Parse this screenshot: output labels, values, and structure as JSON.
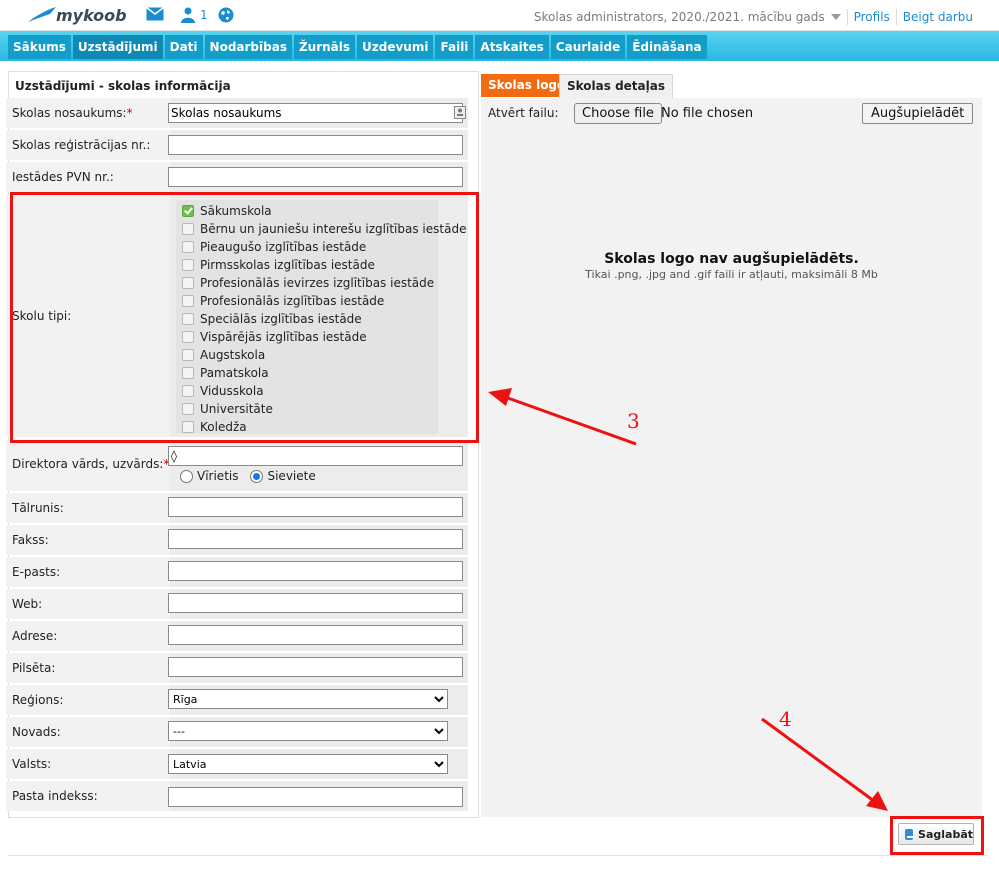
{
  "app": {
    "name": "mykoob",
    "message_count": "1"
  },
  "topbar": {
    "role_text": "Skolas administrators, 2020./2021. mācību gads",
    "profile_link": "Profils",
    "logout_link": "Beigt darbu"
  },
  "menu": [
    "Sākums",
    "Uzstādījumi",
    "Dati",
    "Nodarbības",
    "Žurnāls",
    "Uzdevumi",
    "Faili",
    "Atskaites",
    "Caurlaide",
    "Ēdināšana"
  ],
  "menu_active": "Uzstādījumi",
  "form": {
    "title": "Uzstādījumi - skolas informācija",
    "school_name": {
      "label": "Skolas nosaukums:",
      "required": "*",
      "value": "Skolas nosaukums"
    },
    "reg_no": {
      "label": "Skolas reģistrācijas nr.:",
      "value": ""
    },
    "vat_no": {
      "label": "Iestādes PVN nr.:",
      "value": ""
    },
    "school_types": {
      "label": "Skolu tipi:",
      "items": [
        {
          "label": "Sākumskola",
          "checked": true
        },
        {
          "label": "Bērnu un jauniešu interešu izglītības iestāde",
          "checked": false
        },
        {
          "label": "Pieaugušo izglītības iestāde",
          "checked": false
        },
        {
          "label": "Pirmsskolas izglītības iestāde",
          "checked": false
        },
        {
          "label": "Profesionālās ievirzes izglītības iestāde",
          "checked": false
        },
        {
          "label": "Profesionālās izglītības iestāde",
          "checked": false
        },
        {
          "label": "Speciālās izglītības iestāde",
          "checked": false
        },
        {
          "label": "Vispārējās izglītības iestāde",
          "checked": false
        },
        {
          "label": "Augstskola",
          "checked": false
        },
        {
          "label": "Pamatskola",
          "checked": false
        },
        {
          "label": "Vidusskola",
          "checked": false
        },
        {
          "label": "Universitāte",
          "checked": false
        },
        {
          "label": "Koledža",
          "checked": false
        }
      ]
    },
    "director": {
      "label": "Direktora vārds, uzvārds:",
      "required": "*",
      "value": "◊",
      "gender_male": "Vīrietis",
      "gender_female": "Sieviete",
      "selected_gender": "Sieviete"
    },
    "phone": {
      "label": "Tālrunis:",
      "value": ""
    },
    "fax": {
      "label": "Fakss:",
      "value": ""
    },
    "email": {
      "label": "E-pasts:",
      "value": ""
    },
    "web": {
      "label": "Web:",
      "value": ""
    },
    "address": {
      "label": "Adrese:",
      "value": ""
    },
    "city": {
      "label": "Pilsēta:",
      "value": ""
    },
    "region": {
      "label": "Reģions:",
      "value": "Rīga"
    },
    "district": {
      "label": "Novads:",
      "value": "---"
    },
    "country": {
      "label": "Valsts:",
      "value": "Latvia"
    },
    "postal": {
      "label": "Pasta indekss:",
      "value": ""
    }
  },
  "right": {
    "tab_logo": "Skolas logo",
    "tab_details": "Skolas detaļas",
    "open_file_label": "Atvērt failu:",
    "choose_file": "Choose file",
    "no_file": "No file chosen",
    "upload_button": "Augšupielādēt",
    "no_logo_title": "Skolas logo nav augšupielādēts.",
    "no_logo_sub": "Tikai .png, .jpg and .gif faili ir atļauti, maksimāli 8 Mb"
  },
  "save_button": "Saglabāt",
  "annotations": {
    "marker3": "3",
    "marker4": "4"
  },
  "colors": {
    "accent_blue": "#2ab7e3",
    "active_tab": "#f36b10",
    "annotation": "#ee1111",
    "checked": "#6bc04b"
  }
}
